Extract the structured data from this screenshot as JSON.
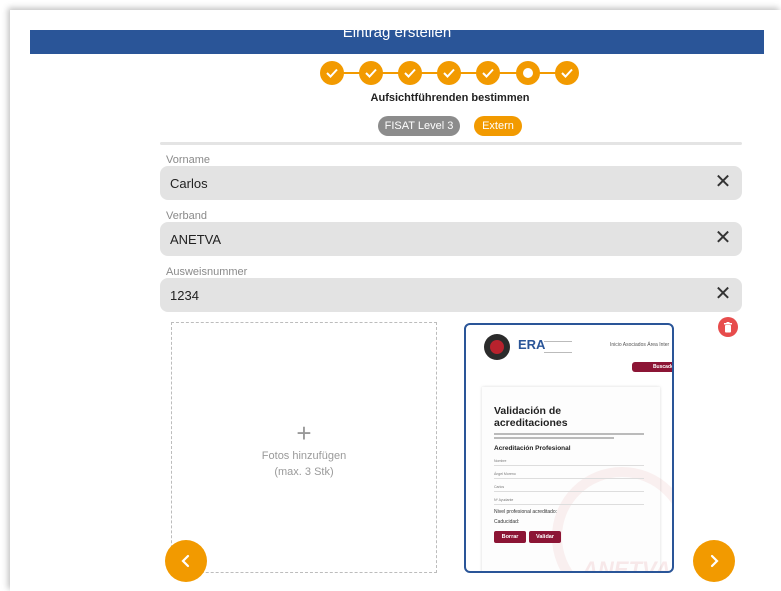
{
  "header": {
    "title": "Eintrag erstellen"
  },
  "stepper": {
    "steps": [
      "done",
      "done",
      "done",
      "done",
      "done",
      "current",
      "done"
    ],
    "title": "Aufsichtführenden bestimmen",
    "accent": "#f29a00"
  },
  "options": {
    "option_1": "FISAT Level 3",
    "option_2": "Extern"
  },
  "form": {
    "vorname": {
      "label": "Vorname",
      "value": "Carlos"
    },
    "verband": {
      "label": "Verband",
      "value": "ANETVA"
    },
    "ausweis": {
      "label": "Ausweisnummer",
      "value": "1234"
    }
  },
  "photos": {
    "add_symbol": "+",
    "add_label": "Fotos hinzufügen",
    "add_hint": "(max. 3 Stk)"
  },
  "preview": {
    "brand": "ERA",
    "nav_text": "Inicio  Asociados  Área Inter",
    "search_button": "Buscador",
    "heading_1": "Validación de",
    "heading_2": "acreditaciones",
    "section_title": "Acreditación Profesional",
    "inputs": [
      "Nombre",
      "Ángel Moreno",
      "Carlos",
      "Nº Ayudante"
    ],
    "level_label": "Nivel profesional acreditado:",
    "validity_label": "Caducidad:",
    "clear_button": "Borrar",
    "validate_button": "Validar",
    "watermark": "ANETVA"
  },
  "colors": {
    "header_blue": "#2a5598",
    "orange": "#f29a00",
    "delete_red": "#e74c4c",
    "preview_button": "#8c1535"
  },
  "icons": {
    "step_done": "check-icon",
    "clear": "close-icon",
    "delete": "trash-icon",
    "prev": "chevron-left-icon",
    "next": "chevron-right-icon"
  }
}
